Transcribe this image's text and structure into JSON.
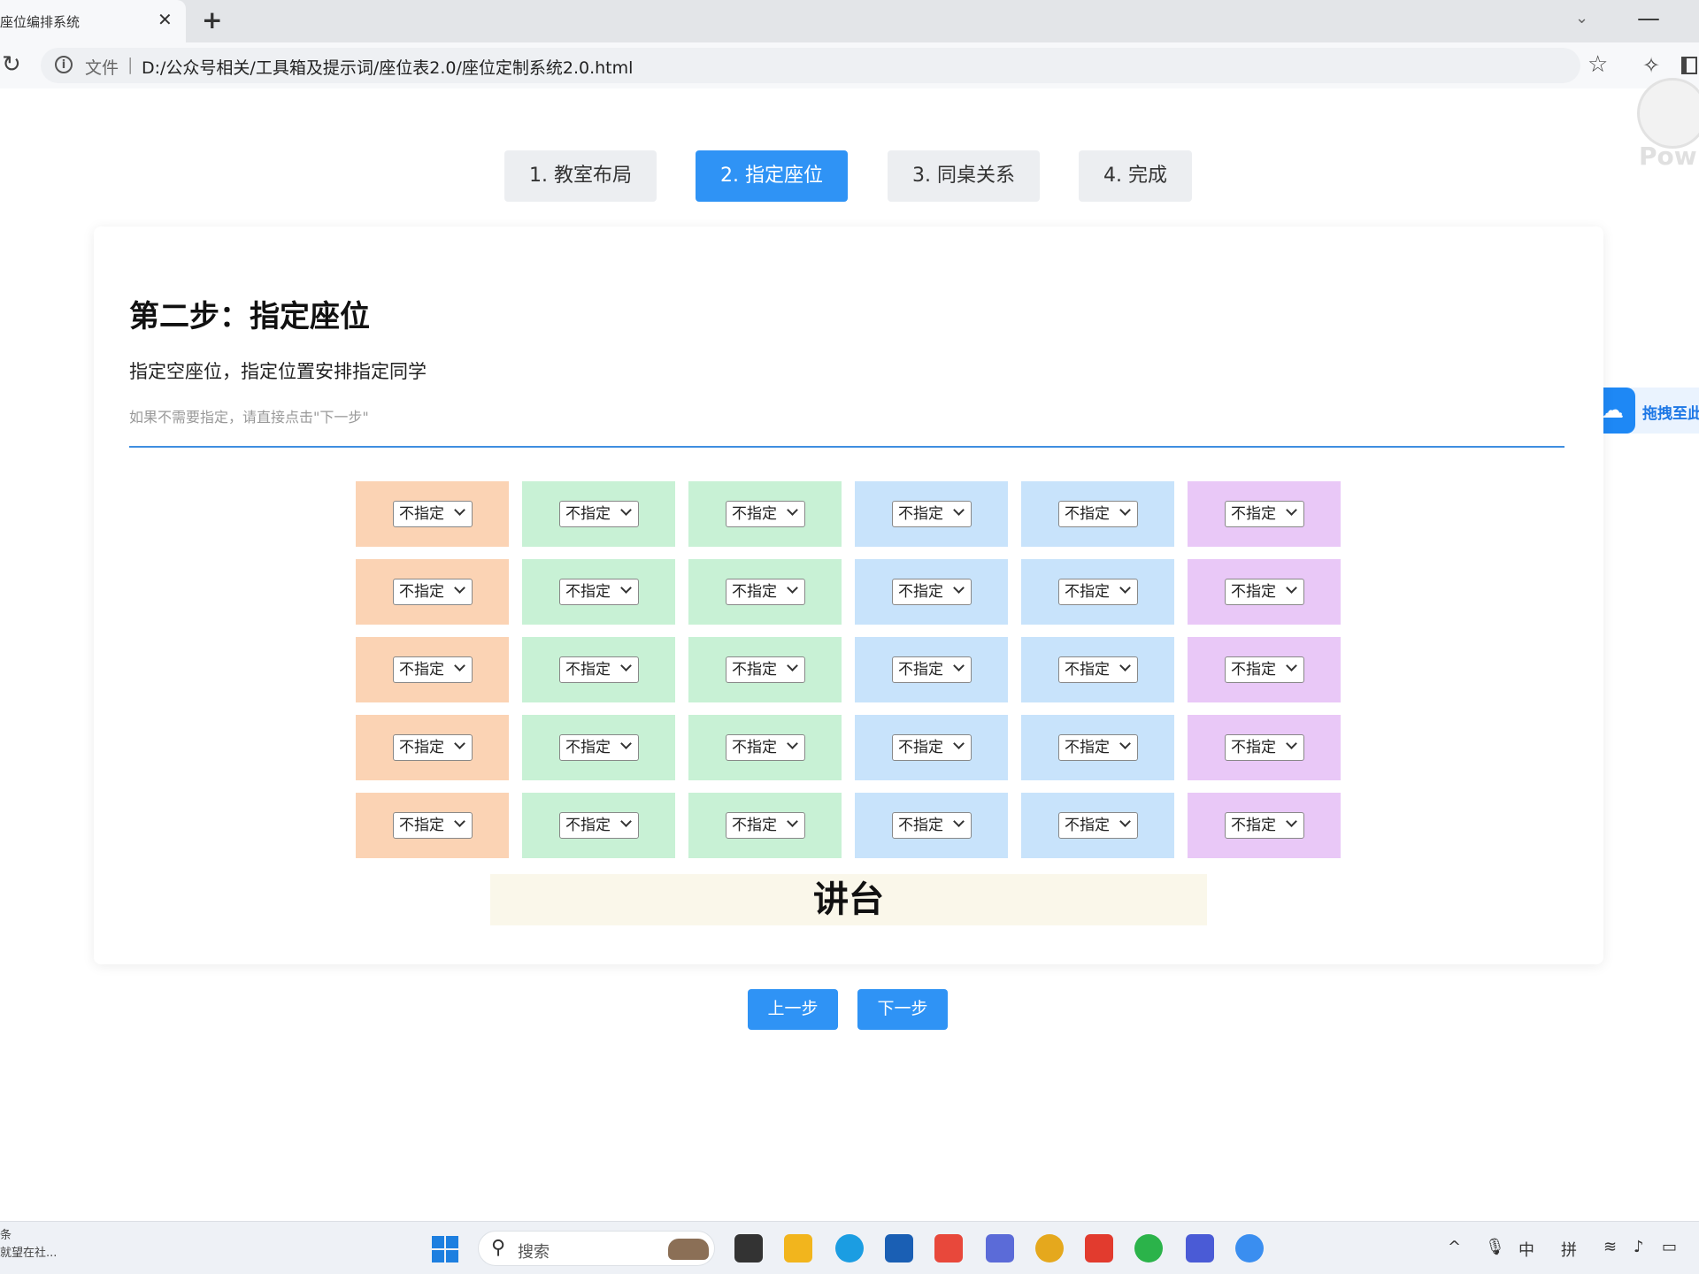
{
  "browser": {
    "tab_title": "座位编排系统",
    "tab_close_glyph": "✕",
    "new_tab_glyph": "+",
    "file_label": "文件",
    "separator": "|",
    "url": "D:/公众号相关/工具箱及提示词/座位表2.0/座位定制系统2.0.html",
    "star_glyph": "☆",
    "tab_list_glyph": "⌄",
    "minimize_glyph": "—"
  },
  "floating": {
    "ghost_text": "Pow",
    "drag_label": "拖拽至此"
  },
  "steps": [
    {
      "label": "1. 教室布局",
      "active": false
    },
    {
      "label": "2. 指定座位",
      "active": true
    },
    {
      "label": "3. 同桌关系",
      "active": false
    },
    {
      "label": "4. 完成",
      "active": false
    }
  ],
  "card": {
    "title": "第二步：指定座位",
    "description": "指定空座位，指定位置安排指定同学",
    "hint": "如果不需要指定，请直接点击\"下一步\""
  },
  "seating": {
    "default_option": "不指定",
    "rows": 5,
    "columns": [
      {
        "color": "#fbd3b4"
      },
      {
        "color": "#c8f1d5"
      },
      {
        "color": "#c8f1d5"
      },
      {
        "color": "#c8e3fb"
      },
      {
        "color": "#c8e3fb"
      },
      {
        "color": "#e9c8f7"
      }
    ],
    "podium_label": "讲台"
  },
  "actions": {
    "prev_label": "上一步",
    "next_label": "下一步"
  },
  "taskbar": {
    "left_line1": "条",
    "left_line2": "就望在社...",
    "search_placeholder": "搜索",
    "tray_lang": "中",
    "tray_ime": "拼",
    "tray_up": "^"
  }
}
